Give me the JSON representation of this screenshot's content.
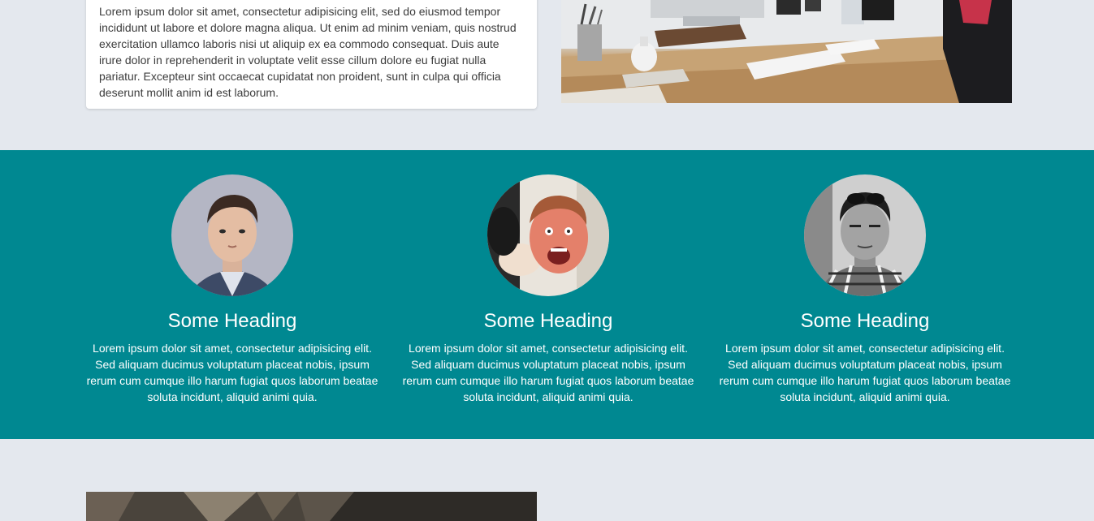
{
  "intro": {
    "paragraph": "Lorem ipsum dolor sit amet, consectetur adipisicing elit, sed do eiusmod tempor incididunt ut labore et dolore magna aliqua. Ut enim ad minim veniam, quis nostrud exercitation ullamco laboris nisi ut aliquip ex ea commodo consequat. Duis aute irure dolor in reprehenderit in voluptate velit esse cillum dolore eu fugiat nulla pariatur. Excepteur sint occaecat cupidatat non proident, sunt in culpa qui officia deserunt mollit anim id est laborum."
  },
  "team": {
    "members": [
      {
        "heading": "Some Heading",
        "text": "Lorem ipsum dolor sit amet, consectetur adipisicing elit. Sed aliquam ducimus voluptatum placeat nobis, ipsum rerum cum cumque illo harum fugiat quos laborum beatae soluta incidunt, aliquid animi quia."
      },
      {
        "heading": "Some Heading",
        "text": "Lorem ipsum dolor sit amet, consectetur adipisicing elit. Sed aliquam ducimus voluptatum placeat nobis, ipsum rerum cum cumque illo harum fugiat quos laborum beatae soluta incidunt, aliquid animi quia."
      },
      {
        "heading": "Some Heading",
        "text": "Lorem ipsum dolor sit amet, consectetur adipisicing elit. Sed aliquam ducimus voluptatum placeat nobis, ipsum rerum cum cumque illo harum fugiat quos laborum beatae soluta incidunt, aliquid animi quia."
      }
    ]
  },
  "colors": {
    "page_background": "#e4e8ee",
    "team_background": "#008891",
    "card_background": "#ffffff"
  }
}
